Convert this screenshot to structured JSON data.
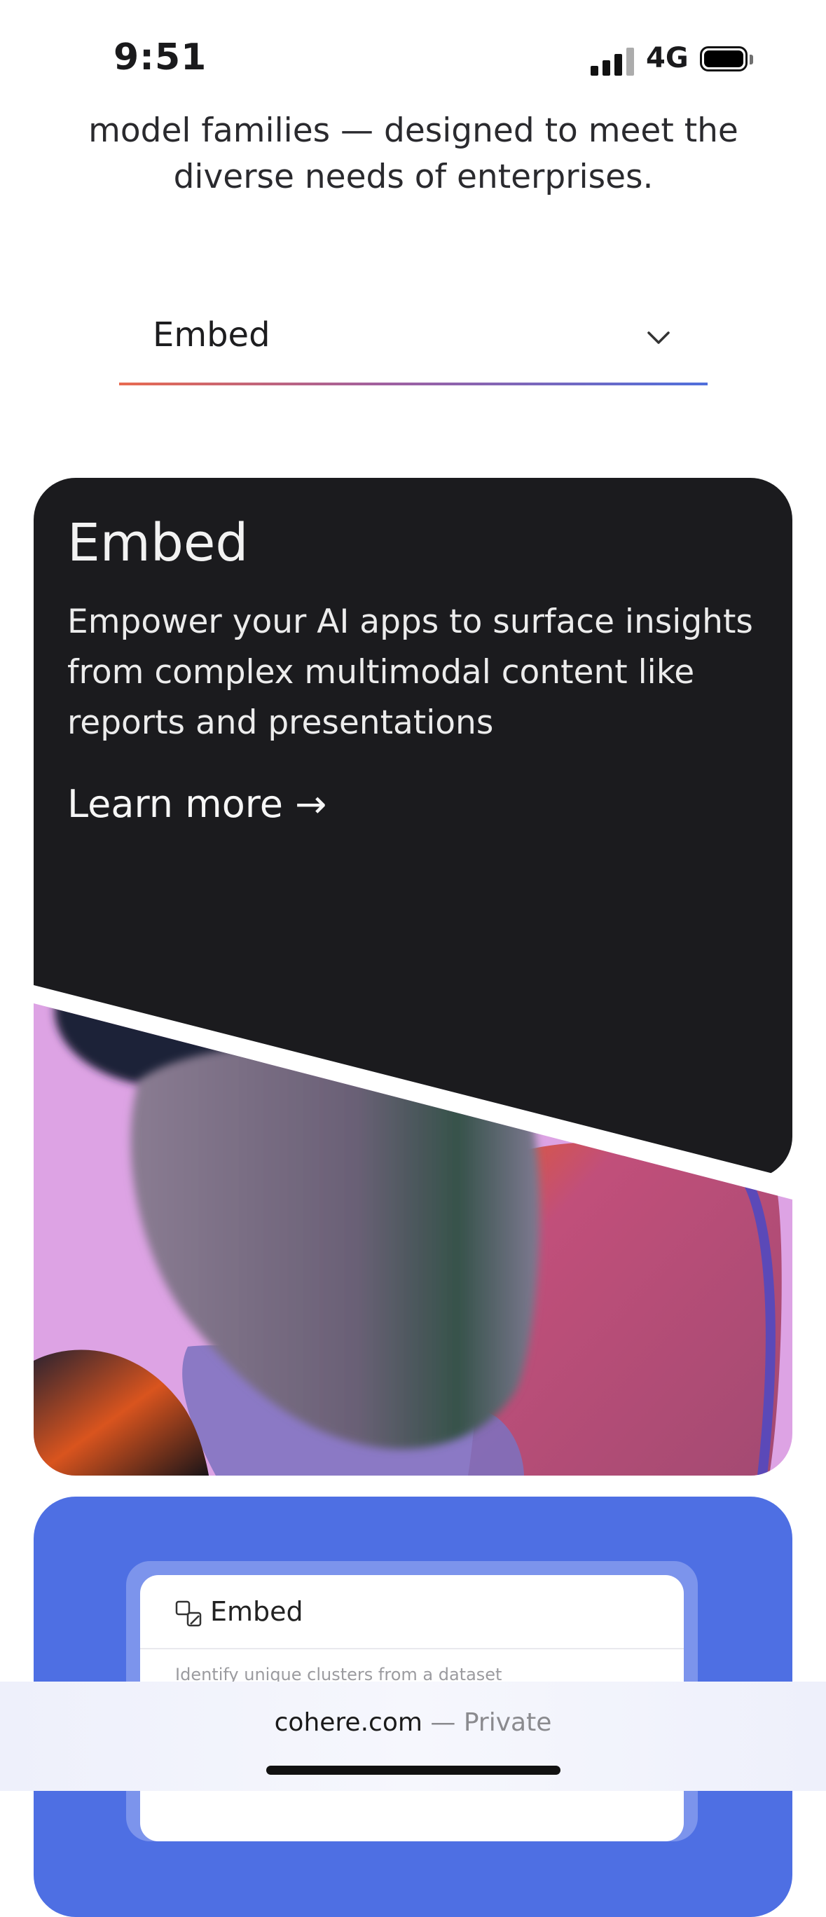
{
  "status_bar": {
    "time": "9:51",
    "network": "4G"
  },
  "intro": {
    "text": "model families — designed to meet the diverse needs of enterprises."
  },
  "dropdown": {
    "selected": "Embed"
  },
  "card": {
    "title": "Embed",
    "description": "Empower your AI apps to surface insights from complex multimodal content like reports and presentations",
    "link": "Learn more →"
  },
  "preview_panel": {
    "title": "Embed",
    "subtitle": "Identify unique clusters from a dataset"
  },
  "browser": {
    "host": "cohere.com",
    "separator": "—",
    "mode": "Private"
  },
  "colors": {
    "accent_blue": "#4e6fe3",
    "card_dark": "#1b1b1e",
    "art_pink": "#dda3e4"
  }
}
